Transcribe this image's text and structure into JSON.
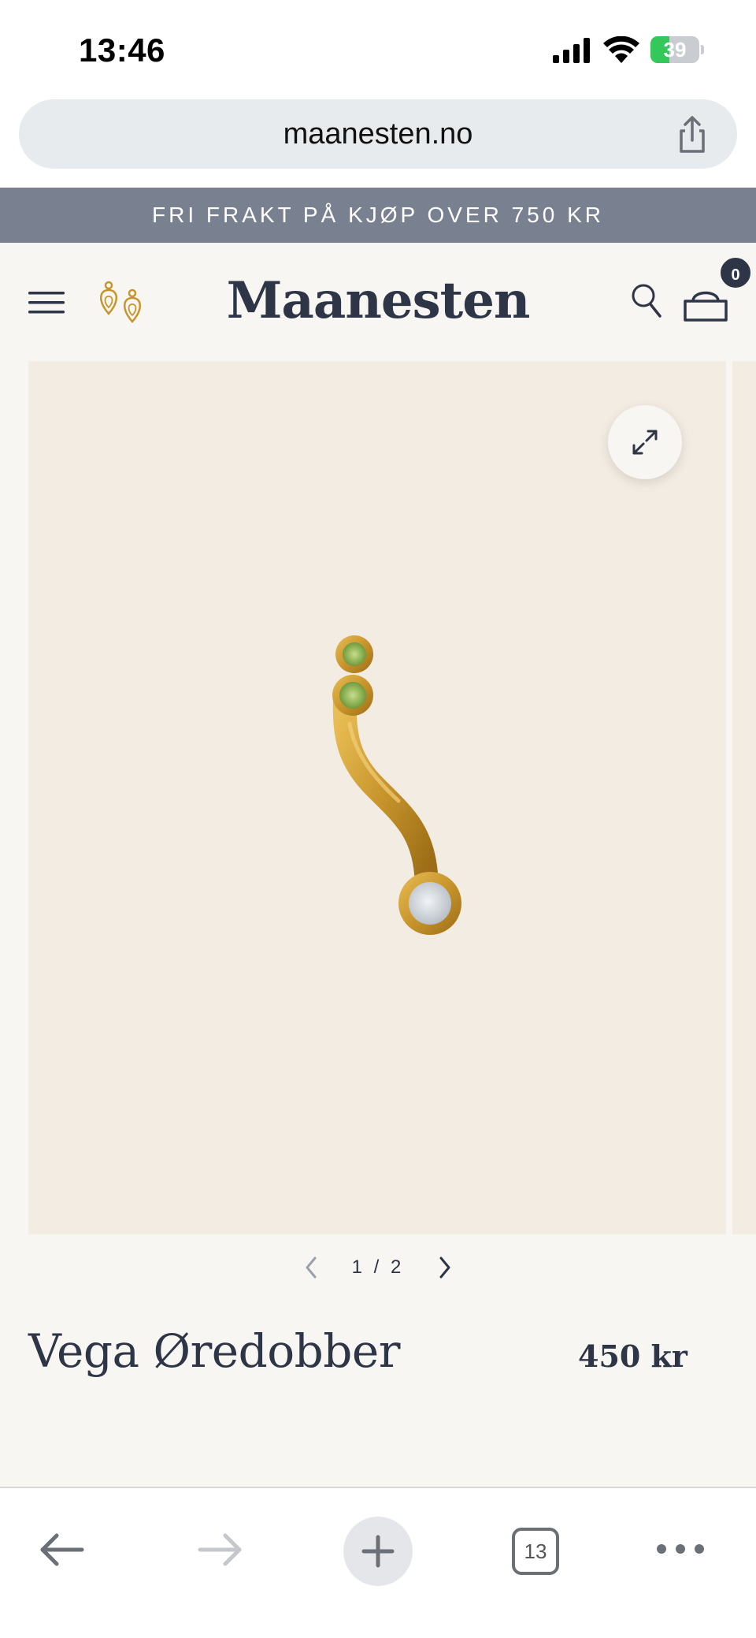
{
  "status_bar": {
    "time": "13:46",
    "battery_percent": "39"
  },
  "browser": {
    "url": "maanesten.no",
    "tab_count": "13"
  },
  "announcement": {
    "text": "FRI FRAKT PÅ KJØP OVER 750 KR"
  },
  "header": {
    "brand": "Maanesten",
    "cart_count": "0"
  },
  "gallery": {
    "current": "1",
    "total": "2",
    "separator": "/"
  },
  "product": {
    "title": "Vega Øredobber",
    "price": "450 kr"
  },
  "colors": {
    "announcement_bg": "#798190",
    "brand_text": "#2d3547",
    "gallery_bg": "#f3ece2",
    "page_bg": "#f8f6f2",
    "gold": "#c8952c",
    "stone_green": "#8fb15a"
  },
  "icons": {
    "signal": "signal-icon",
    "wifi": "wifi-icon",
    "battery": "battery-icon",
    "share": "share-icon",
    "menu": "menu-icon",
    "logo": "earring-logo-icon",
    "search": "search-icon",
    "cart": "bag-icon",
    "expand": "expand-icon",
    "prev": "chevron-left-icon",
    "next": "chevron-right-icon",
    "back": "arrow-left-icon",
    "forward": "arrow-right-icon",
    "new_tab": "plus-icon",
    "more": "more-icon"
  }
}
